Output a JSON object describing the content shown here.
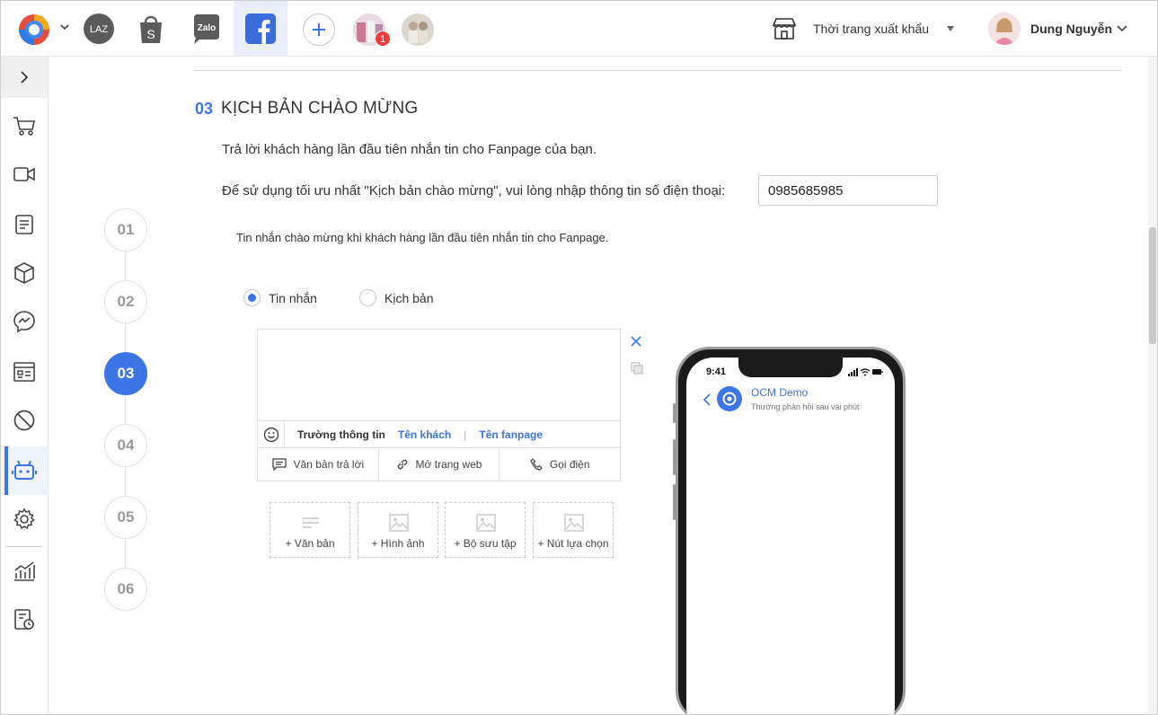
{
  "topbar": {
    "channels": [
      "lazada-icon",
      "shopee-icon",
      "zalo-icon",
      "facebook-icon"
    ],
    "notification_count": "1",
    "shop_name": "Thời trang xuất khẩu",
    "user_name": "Dung Nguyễn"
  },
  "sidebar": {
    "items": [
      "cart-icon",
      "video-icon",
      "document-icon",
      "box-icon",
      "messenger-icon",
      "form-icon",
      "block-icon",
      "bot-icon",
      "gear-icon",
      "chart-icon",
      "report-clock-icon"
    ],
    "active_item": "bot-icon"
  },
  "section": {
    "number": "03",
    "title": "KỊCH BẢN CHÀO MỪNG",
    "description": "Trả lời khách hàng lần đầu tiên nhắn tin cho Fanpage của bạn.",
    "phone_prompt": "Để sử dụng tối ưu nhất \"Kịch bản chào mừng\", vui lòng nhập thông tin số điện thoại:",
    "phone_value": "0985685985",
    "sub_description": "Tin nhắn chào mừng khi khách hàng lần đầu tiên nhắn tin cho Fanpage."
  },
  "steps": [
    "01",
    "02",
    "03",
    "04",
    "05",
    "06"
  ],
  "active_step": "03",
  "message_type": {
    "options": [
      "Tin nhắn",
      "Kịch bản"
    ],
    "selected": "Tin nhắn"
  },
  "editor": {
    "field_label": "Trường thông tin",
    "tag_customer": "Tên khách",
    "tag_separator": "|",
    "tag_fanpage": "Tên fanpage",
    "buttons": [
      "Văn bản trả lời",
      "Mở trang web",
      "Gọi điện"
    ]
  },
  "add_blocks": [
    "+ Văn bản",
    "+ Hình ảnh",
    "+ Bộ sưu tập",
    "+ Nút lựa chọn"
  ],
  "preview": {
    "time": "9:41",
    "page_name": "OCM Demo",
    "page_status": "Thường phản hồi sau vài phút"
  },
  "colors": {
    "accent": "#3d74e6",
    "badge": "#f03b3b"
  }
}
